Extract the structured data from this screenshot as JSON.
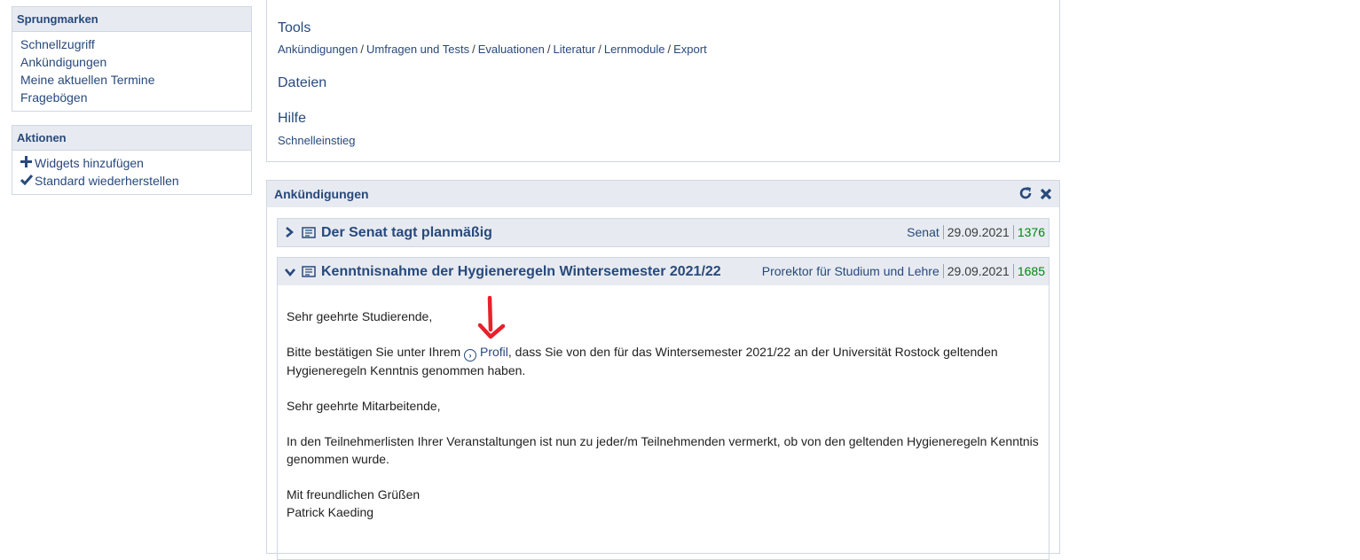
{
  "sidebar": {
    "jump": {
      "title": "Sprungmarken",
      "items": [
        "Schnellzugriff",
        "Ankündigungen",
        "Meine aktuellen Termine",
        "Fragebögen"
      ]
    },
    "actions": {
      "title": "Aktionen",
      "items": [
        {
          "icon": "plus-icon",
          "label": "Widgets hinzufügen"
        },
        {
          "icon": "check-icon",
          "label": "Standard wiederherstellen"
        }
      ]
    }
  },
  "quick": {
    "tools_title": "Tools",
    "tools_links": [
      "Ankündigungen",
      "Umfragen und Tests",
      "Evaluationen",
      "Literatur",
      "Lernmodule",
      "Export"
    ],
    "files_title": "Dateien",
    "help_title": "Hilfe",
    "help_links": [
      "Schnelleinstieg"
    ]
  },
  "widget": {
    "title": "Ankündigungen",
    "icons": [
      "refresh-icon",
      "close-icon"
    ],
    "news": [
      {
        "title": "Der Senat tagt planmäßig",
        "author": "Senat",
        "date": "29.09.2021",
        "views": "1376",
        "expanded": false
      },
      {
        "title": "Kenntnisnahme der Hygieneregeln Wintersemester 2021/22",
        "author": "Prorektor für Studium und Lehre",
        "date": "29.09.2021",
        "views": "1685",
        "expanded": true
      }
    ],
    "body": {
      "greeting_students": "Sehr geehrte Studierende,",
      "p1_before": "Bitte bestätigen Sie unter Ihrem",
      "p1_link": "Profil",
      "p1_after": ", dass Sie von den für das Wintersemester 2021/22 an der Universität Rostock geltenden Hygieneregeln Kenntnis genommen haben.",
      "greeting_staff": "Sehr geehrte Mitarbeitende,",
      "p2": "In den Teilnehmerlisten Ihrer Veranstaltungen ist nun zu jeder/m Teilnehmenden vermerkt, ob von den geltenden Hygieneregeln Kenntnis genommen wurde.",
      "closing": "Mit freundlichen Grüßen",
      "signature": "Patrick Kaeding"
    }
  },
  "colors": {
    "brand": "#28497c",
    "header_bg": "#e7ebf1",
    "views": "#008512",
    "arrow": "#e8202a"
  }
}
